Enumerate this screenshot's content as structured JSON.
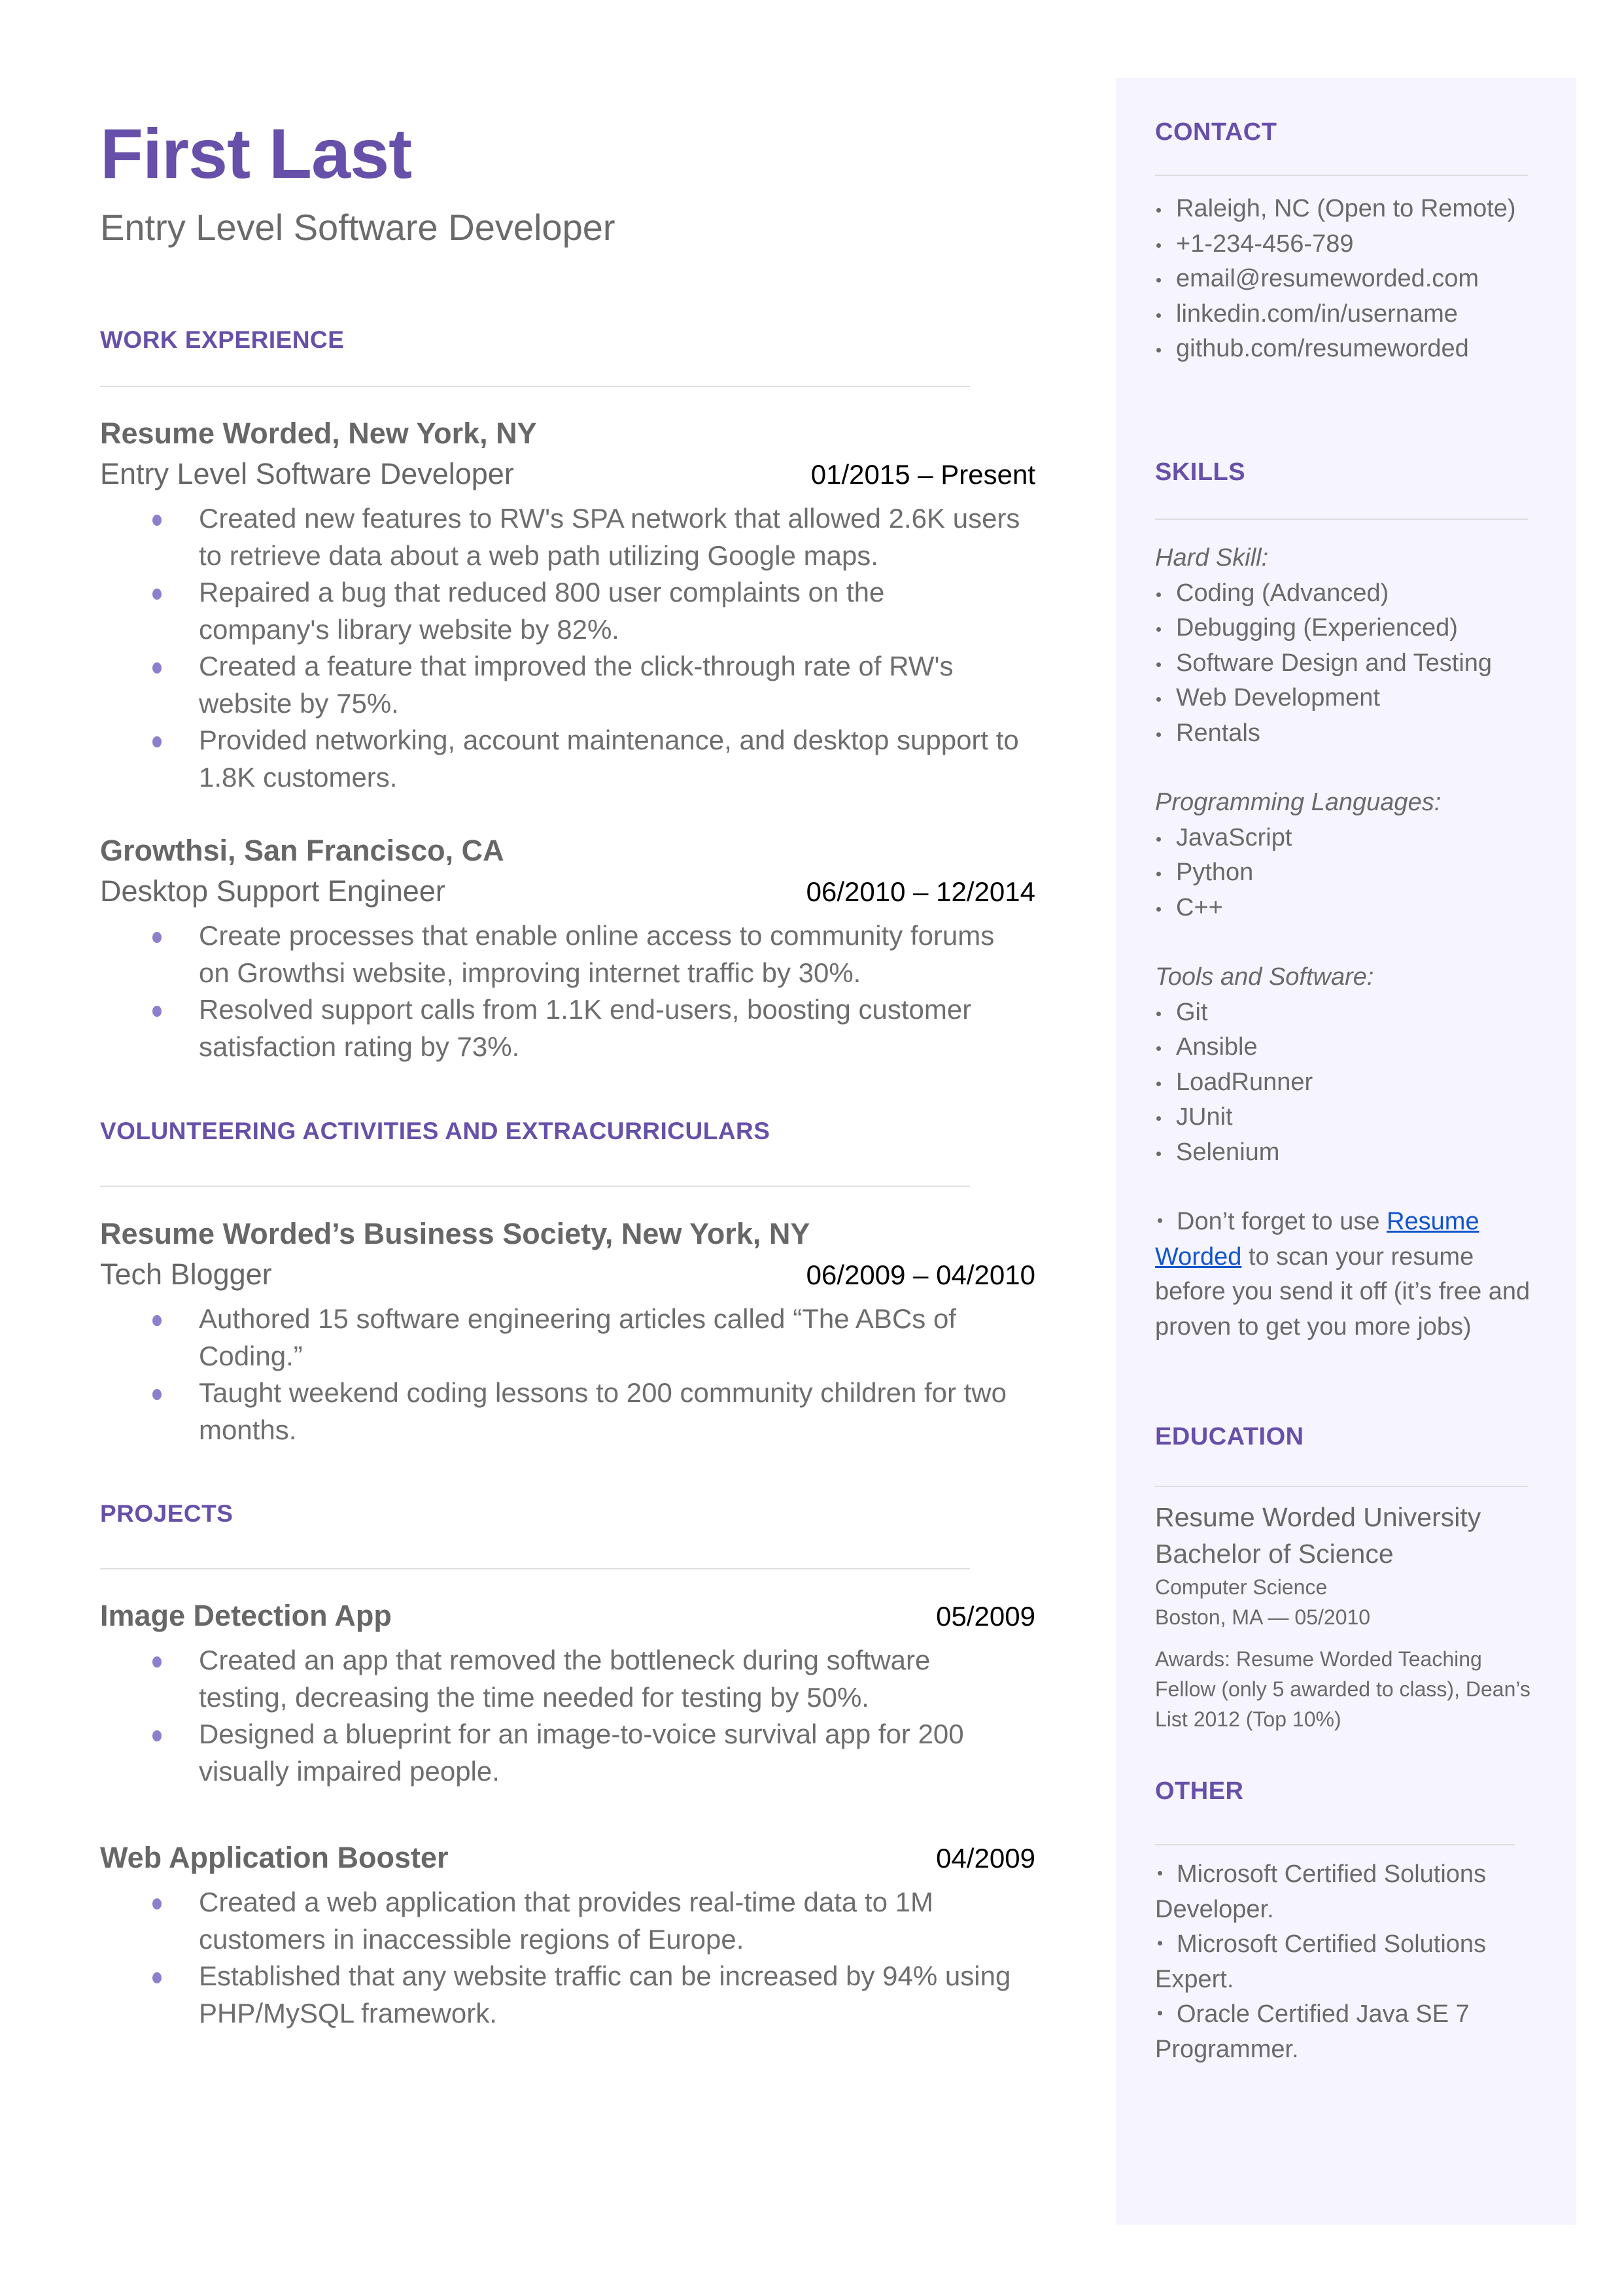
{
  "header": {
    "name": "First Last",
    "title": "Entry Level Software Developer"
  },
  "colors": {
    "accent": "#6750a9",
    "bullet": "#8e7fcd",
    "sidebar_bg": "#f6f4fe",
    "link": "#1155cc",
    "text": "#676767"
  },
  "work": {
    "heading": "WORK EXPERIENCE",
    "entries": [
      {
        "org": "Resume Worded, New York, NY",
        "role": "Entry Level Software Developer",
        "dates": "01/2015 – Present",
        "bullets": [
          "Created new features to RW's SPA network that allowed 2.6K users to retrieve data about a web path utilizing Google maps.",
          "Repaired a bug that reduced 800 user complaints on the company's library website by 82%.",
          "Created a feature that improved the click-through rate of RW's website by 75%.",
          "Provided networking, account maintenance, and desktop support to 1.8K customers."
        ]
      },
      {
        "org": "Growthsi, San Francisco, CA",
        "role": "Desktop Support Engineer",
        "dates": "06/2010 – 12/2014",
        "bullets": [
          "Create processes that enable online access to community forums on Growthsi website, improving internet traffic by 30%.",
          "Resolved support calls from 1.1K end-users, boosting customer satisfaction rating by 73%."
        ]
      }
    ]
  },
  "volunteering": {
    "heading": "VOLUNTEERING ACTIVITIES AND EXTRACURRICULARS",
    "entries": [
      {
        "org": "Resume Worded’s Business Society, New York, NY",
        "role": "Tech Blogger",
        "dates": "06/2009 – 04/2010",
        "bullets": [
          "Authored 15 software engineering articles called “The ABCs of Coding.”",
          "Taught weekend coding lessons to 200 community children for two months."
        ]
      }
    ]
  },
  "projects": {
    "heading": "PROJECTS",
    "entries": [
      {
        "name": "Image Detection App",
        "date": "05/2009",
        "bullets": [
          "Created an app that removed the bottleneck during software testing, decreasing the time needed for testing by 50%.",
          "Designed a blueprint for an image-to-voice survival app for 200 visually impaired people."
        ]
      },
      {
        "name": "Web Application Booster",
        "date": "04/2009",
        "bullets": [
          "Created a web application that provides real-time data to 1M customers in inaccessible regions of Europe.",
          "Established that any website traffic can be increased by 94% using PHP/MySQL framework."
        ]
      }
    ]
  },
  "contact": {
    "heading": "CONTACT",
    "items": [
      "Raleigh, NC (Open to Remote)",
      "+1-234-456-789",
      "email@resumeworded.com",
      "linkedin.com/in/username",
      "github.com/resumeworded"
    ]
  },
  "skills": {
    "heading": "SKILLS",
    "groups": [
      {
        "label": "Hard Skill:",
        "items": [
          "Coding (Advanced)",
          "Debugging (Experienced)",
          "Software Design and Testing",
          "Web Development",
          "Rentals"
        ]
      },
      {
        "label": "Programming Languages:",
        "items": [
          "JavaScript",
          "Python",
          "C++"
        ]
      },
      {
        "label": "Tools and Software:",
        "items": [
          "Git",
          "Ansible",
          "LoadRunner",
          "JUnit",
          "Selenium"
        ]
      }
    ],
    "tip": {
      "before": "Don’t forget to use ",
      "link": "Resume Worded",
      "after": " to scan your resume before you send it off (it’s free and proven to get you more jobs)"
    }
  },
  "education": {
    "heading": "EDUCATION",
    "school": "Resume Worded University",
    "degree": "Bachelor of Science",
    "field": "Computer Science",
    "location_date": "Boston, MA — 05/2010",
    "awards": "Awards: Resume Worded Teaching Fellow (only 5 awarded to class), Dean’s List 2012 (Top 10%)"
  },
  "other": {
    "heading": "OTHER",
    "items": [
      "Microsoft Certified Solutions Developer.",
      "Microsoft Certified Solutions Expert.",
      "Oracle Certified Java SE 7 Programmer."
    ]
  }
}
